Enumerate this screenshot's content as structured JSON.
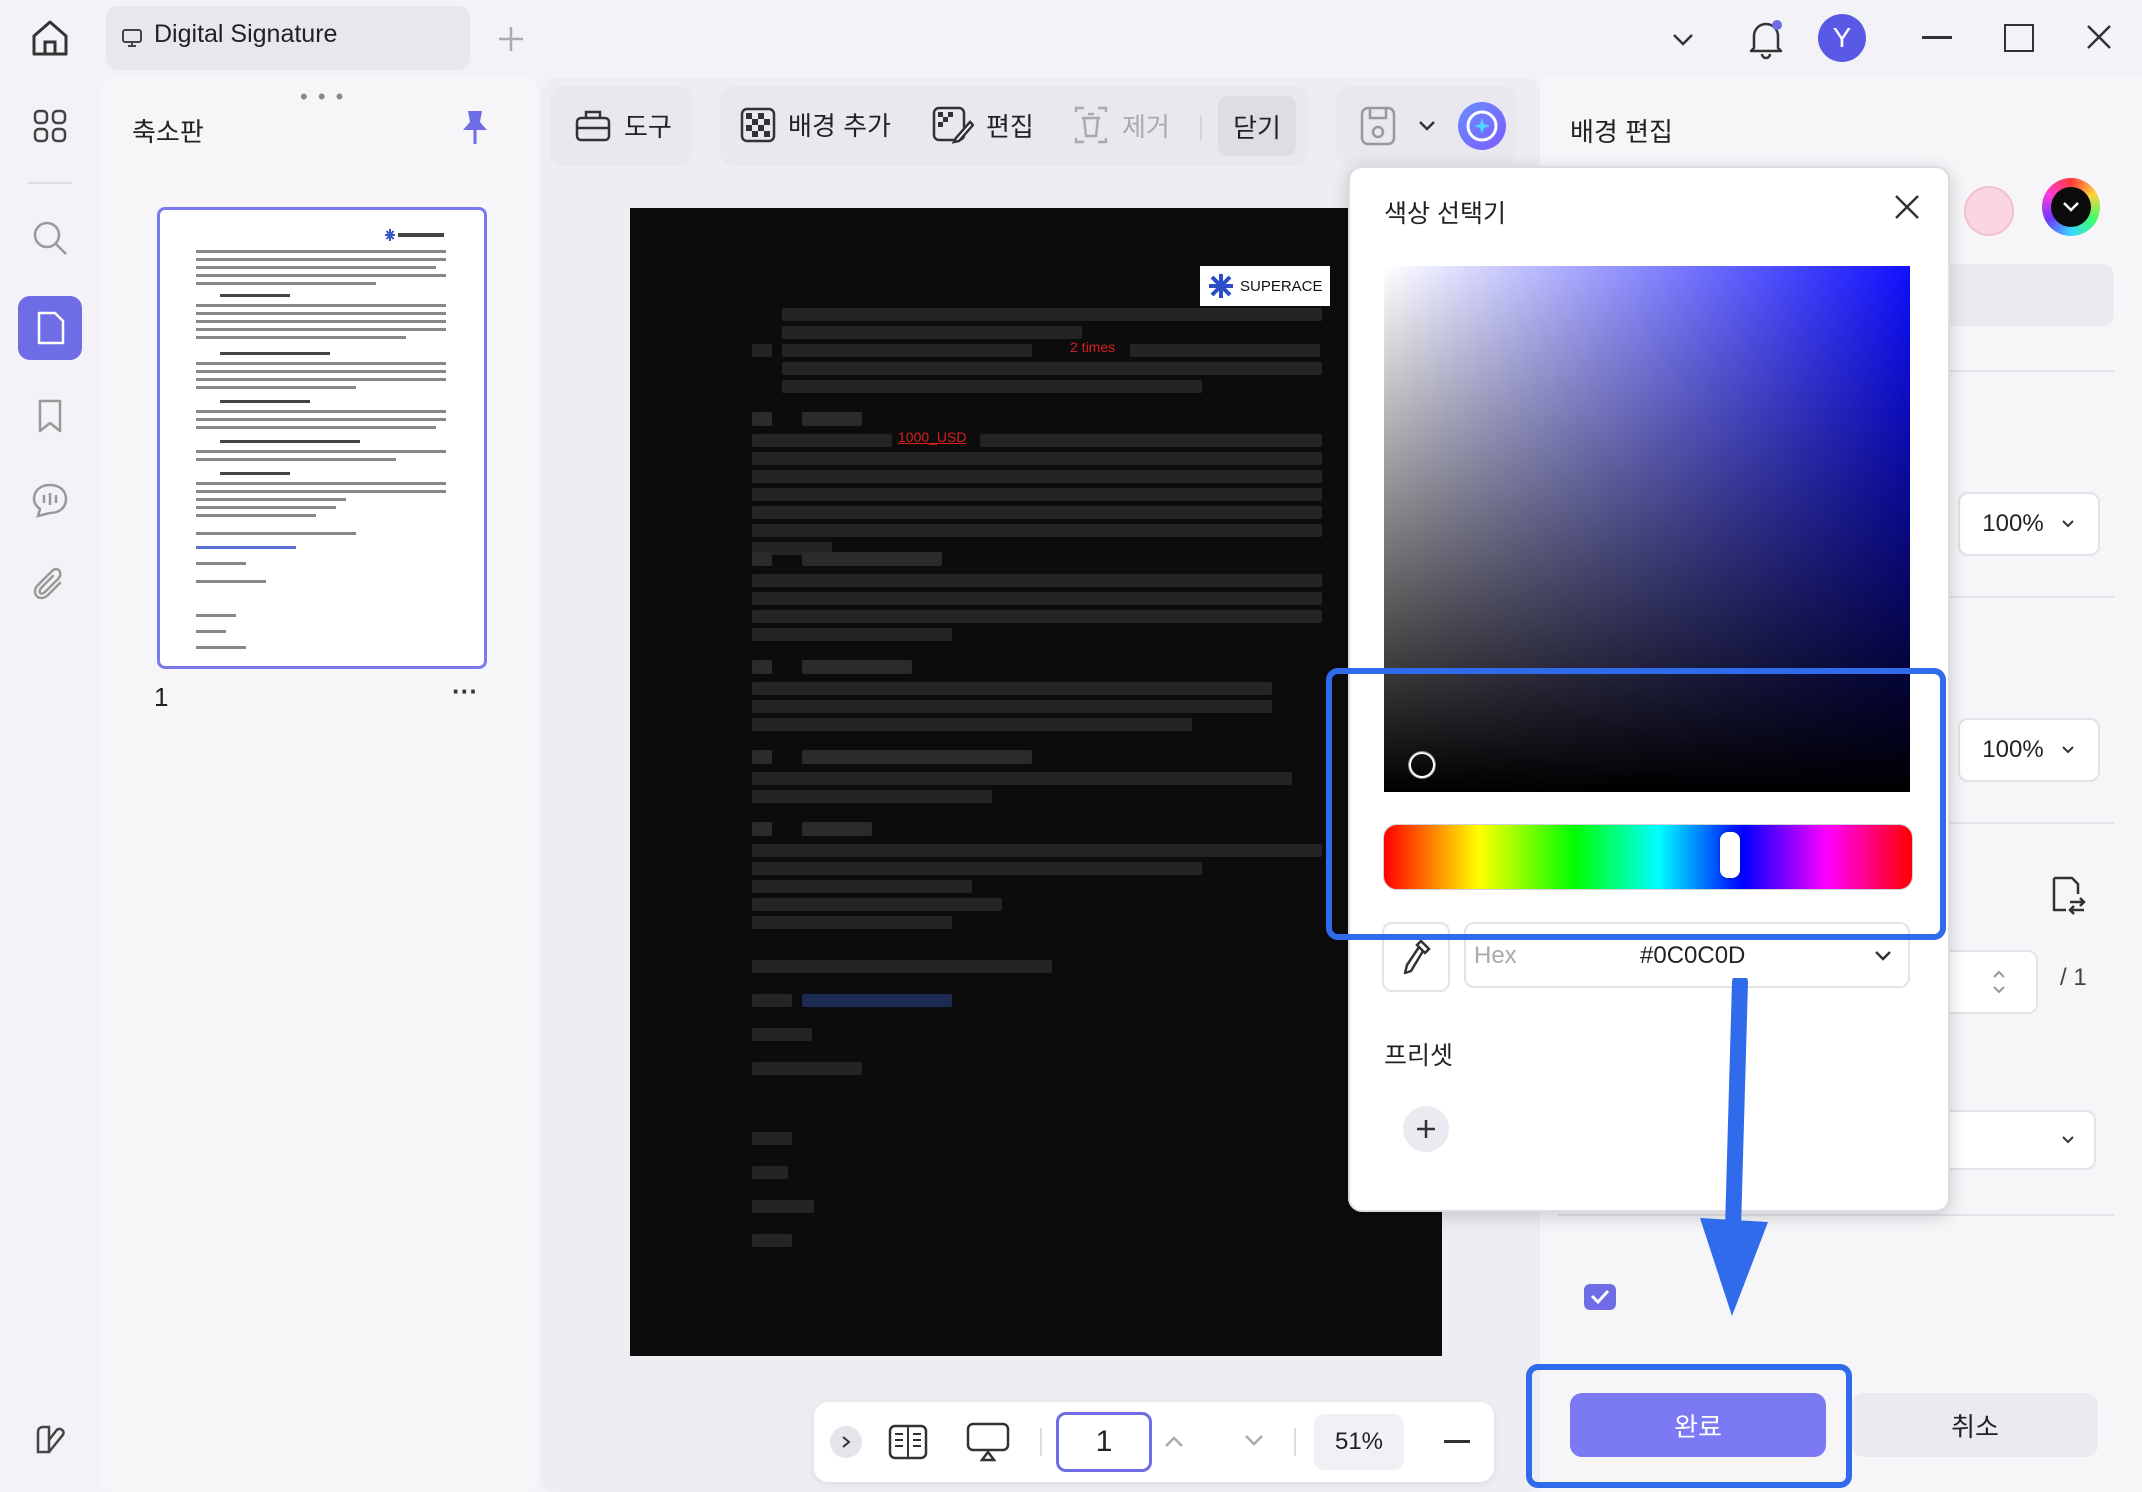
{
  "titlebar": {
    "tab_title": "Digital Signature",
    "avatar_letter": "Y"
  },
  "thumbnails": {
    "title": "축소판",
    "page_label": "1",
    "more": "···"
  },
  "toolbar": {
    "tools": "도구",
    "add_background": "배경 추가",
    "edit": "편집",
    "remove": "제거",
    "close": "닫기"
  },
  "document": {
    "logo_text": "SUPERACE",
    "highlight_1": "2 times",
    "highlight_2": "1000_USD"
  },
  "right_panel": {
    "title": "배경 편집",
    "opacity_1": "100%",
    "opacity_2": "100%",
    "page_total": "/ 1",
    "done": "완료",
    "cancel": "취소"
  },
  "color_picker": {
    "title": "색상 선택기",
    "mode": "Hex",
    "value": "#0C0C0D",
    "presets_label": "프리셋"
  },
  "bottombar": {
    "page": "1",
    "zoom": "51%"
  },
  "colors": {
    "accent": "#7B7AF4",
    "highlight_box": "#2F6BEA",
    "picked": "#0C0C0D"
  }
}
